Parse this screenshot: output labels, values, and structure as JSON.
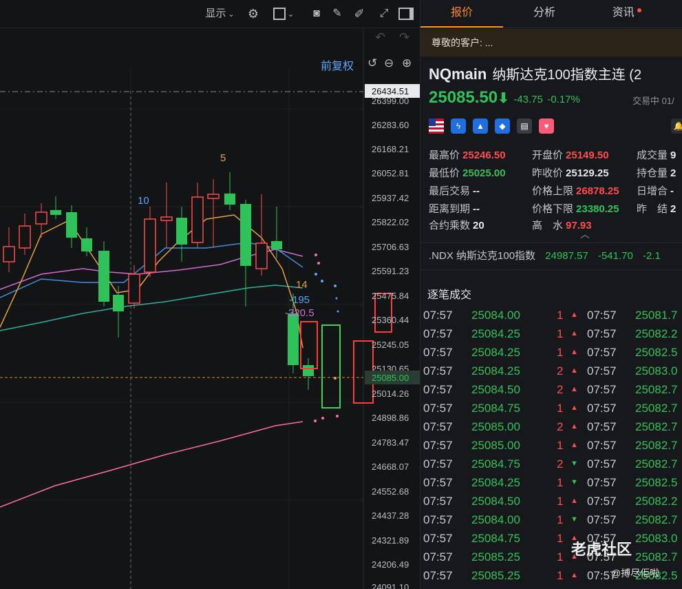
{
  "toolbar": {
    "display_label": "显示",
    "restore_label": "前复权"
  },
  "price_axis": [
    "26434.51",
    "26399.00",
    "26283.60",
    "26168.21",
    "26052.81",
    "25937.42",
    "25822.02",
    "25706.63",
    "25591.23",
    "25475.84",
    "25360.44",
    "25245.05",
    "25130.65",
    "25085.00",
    "25014.26",
    "24898.86",
    "24783.47",
    "24668.07",
    "24552.68",
    "24437.28",
    "24321.89",
    "24206.49",
    "24091.10"
  ],
  "chart_labels": {
    "top_count": "5",
    "left_count": "10",
    "count_14": "14",
    "neg_195": "-195",
    "neg_320": "-320.5"
  },
  "colors": {
    "up": "#ff4d4f",
    "down": "#2fc25b",
    "accent": "#ff8a1e",
    "link": "#5aa6ff"
  },
  "tabs": [
    {
      "label": "报价",
      "active": true
    },
    {
      "label": "分析",
      "active": false
    },
    {
      "label": "资讯",
      "active": false,
      "dot": true
    }
  ],
  "notice": "尊敬的客户: ...",
  "symbol": {
    "code": "NQmain",
    "name": "纳斯达克100指数主连 (2"
  },
  "quote": {
    "price": "25085.50",
    "arrow": "⬇",
    "change": "-43.75",
    "pct": "-0.17%",
    "status": "交易中 01/"
  },
  "icons": [
    "us-flag-icon",
    "lightning-icon",
    "pyramid-icon",
    "tag-icon",
    "doc-icon",
    "heart-icon",
    "bell-icon"
  ],
  "stats": {
    "high": {
      "k": "最高价",
      "v": "25246.50"
    },
    "low": {
      "k": "最低价",
      "v": "25025.00"
    },
    "last_trade": {
      "k": "最后交易",
      "v": "--"
    },
    "to_expiry": {
      "k": "距离到期",
      "v": "--"
    },
    "multiplier": {
      "k": "合约乘数",
      "v": "20"
    },
    "open": {
      "k": "开盘价",
      "v": "25149.50"
    },
    "prev_close": {
      "k": "昨收价",
      "v": "25129.25"
    },
    "limit_up": {
      "k": "价格上限",
      "v": "26878.25"
    },
    "limit_down": {
      "k": "价格下限",
      "v": "23380.25"
    },
    "high_water": {
      "k": "高　水",
      "v": "97.93"
    },
    "volume": {
      "k": "成交量",
      "v": "9"
    },
    "open_interest": {
      "k": "持仓量",
      "v": "2"
    },
    "daily_add": {
      "k": "日增合",
      "v": "-"
    },
    "prev_settle": {
      "k": "昨　结",
      "v": "2"
    }
  },
  "ndx": {
    "code": ".NDX",
    "name": "纳斯达克100指数",
    "price": "24987.57",
    "change": "-541.70",
    "pct": "-2.1"
  },
  "trades_title": "逐笔成交",
  "trades": [
    {
      "t1": "07:57",
      "p1": "25084.00",
      "q1": "1",
      "t2": "07:57",
      "p2": "25081.7",
      "dir": "up"
    },
    {
      "t1": "07:57",
      "p1": "25084.25",
      "q1": "1",
      "t2": "07:57",
      "p2": "25082.2",
      "dir": "up"
    },
    {
      "t1": "07:57",
      "p1": "25084.25",
      "q1": "1",
      "t2": "07:57",
      "p2": "25082.5",
      "dir": "up"
    },
    {
      "t1": "07:57",
      "p1": "25084.25",
      "q1": "2",
      "t2": "07:57",
      "p2": "25083.0",
      "dir": "up"
    },
    {
      "t1": "07:57",
      "p1": "25084.50",
      "q1": "2",
      "t2": "07:57",
      "p2": "25082.7",
      "dir": "up"
    },
    {
      "t1": "07:57",
      "p1": "25084.75",
      "q1": "1",
      "t2": "07:57",
      "p2": "25082.7",
      "dir": "up"
    },
    {
      "t1": "07:57",
      "p1": "25085.00",
      "q1": "2",
      "t2": "07:57",
      "p2": "25082.7",
      "dir": "up"
    },
    {
      "t1": "07:57",
      "p1": "25085.00",
      "q1": "1",
      "t2": "07:57",
      "p2": "25082.7",
      "dir": "up"
    },
    {
      "t1": "07:57",
      "p1": "25084.75",
      "q1": "2",
      "t2": "07:57",
      "p2": "25082.7",
      "dir": "down"
    },
    {
      "t1": "07:57",
      "p1": "25084.25",
      "q1": "1",
      "t2": "07:57",
      "p2": "25082.5",
      "dir": "down"
    },
    {
      "t1": "07:57",
      "p1": "25084.50",
      "q1": "1",
      "t2": "07:57",
      "p2": "25082.2",
      "dir": "up"
    },
    {
      "t1": "07:57",
      "p1": "25084.00",
      "q1": "1",
      "t2": "07:57",
      "p2": "25082.7",
      "dir": "down"
    },
    {
      "t1": "07:57",
      "p1": "25084.75",
      "q1": "1",
      "t2": "07:57",
      "p2": "25083.0",
      "dir": "up"
    },
    {
      "t1": "07:57",
      "p1": "25085.25",
      "q1": "1",
      "t2": "07:57",
      "p2": "25082.7",
      "dir": "up"
    },
    {
      "t1": "07:57",
      "p1": "25085.25",
      "q1": "1",
      "t2": "07:57",
      "p2": "25082.5",
      "dir": "up"
    }
  ],
  "watermark": {
    "brand": "老虎社区",
    "handle": "@搏尽佢啦"
  }
}
